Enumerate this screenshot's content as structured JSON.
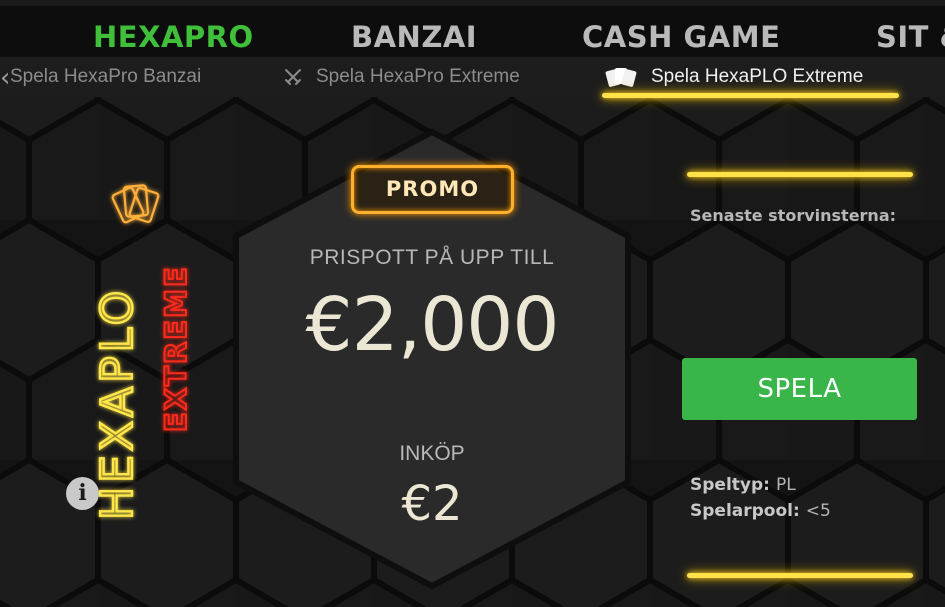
{
  "top_tabs": [
    {
      "label": "HEXAPRO",
      "active": true
    },
    {
      "label": "BANZAI",
      "active": false
    },
    {
      "label": "CASH GAME",
      "active": false
    },
    {
      "label": "SIT &",
      "active": false
    }
  ],
  "sub_tabs": [
    {
      "label": "Spela HexaPro Banzai",
      "icon": "chevron-left-icon"
    },
    {
      "label": "Spela HexaPro Extreme",
      "icon": "crossed-swords-icon"
    },
    {
      "label": "Spela HexaPLO Extreme",
      "icon": "playing-cards-icon",
      "active": true
    }
  ],
  "logo": {
    "word1": "HEXAPLO",
    "word2": "EXTREME"
  },
  "promo": {
    "badge": "PROMO",
    "prize_label": "PRISPOTT PÅ UPP TILL",
    "prize_value": "€2,000",
    "buyin_label": "INKÖP",
    "buyin_value": "€2"
  },
  "info_icon": "i",
  "right_panel": {
    "recent_winners_label": "Senaste storvinsterna:",
    "play_button": "SPELA",
    "game_type_label": "Speltyp:",
    "game_type_value": "PL",
    "player_pool_label": "Spelarpool:",
    "player_pool_value": "<5"
  },
  "colors": {
    "accent_green": "#3fbf3a",
    "button_green": "#39b54a",
    "neon_yellow": "#ffe24a",
    "neon_orange": "#ffb12e",
    "neon_red": "#ff2a1a"
  }
}
